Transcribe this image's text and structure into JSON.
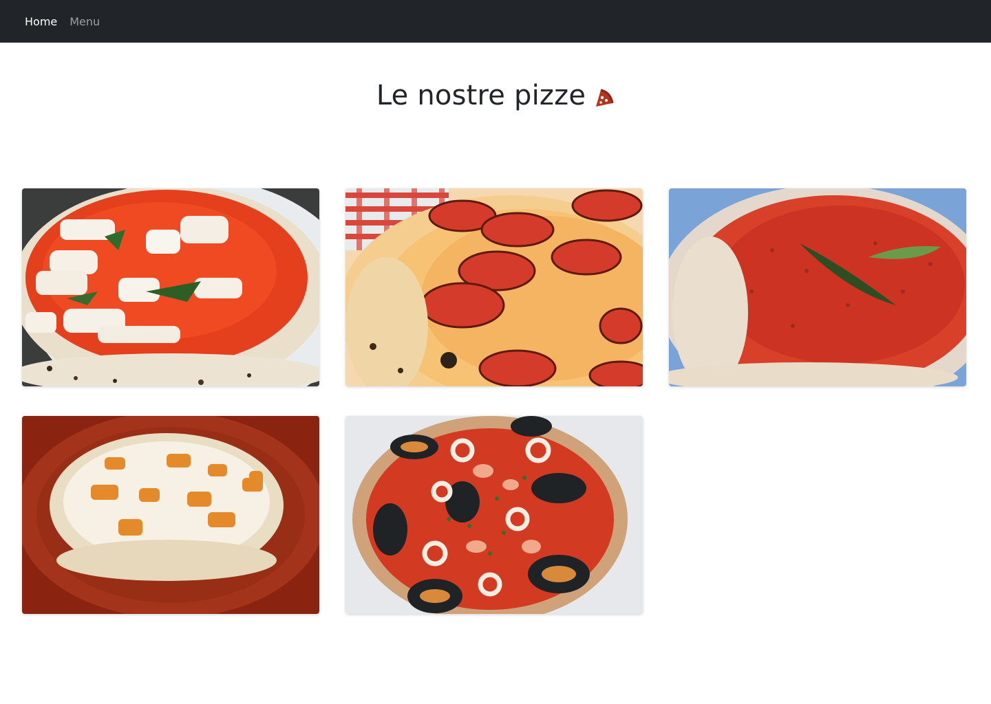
{
  "navbar": {
    "links": [
      {
        "label": "Home",
        "active": true
      },
      {
        "label": "Menu",
        "active": false
      }
    ],
    "background": "#212529"
  },
  "page": {
    "title": "Le nostre pizze",
    "title_icon": "pizza-slice-icon",
    "accent": "#b5341c"
  },
  "pizzas": [
    {
      "image": "pizza-margherita-image"
    },
    {
      "image": "pizza-salame-image"
    },
    {
      "image": "pizza-marinara-image"
    },
    {
      "image": "pizza-bianca-image"
    },
    {
      "image": "pizza-frutti-di-mare-image"
    }
  ]
}
